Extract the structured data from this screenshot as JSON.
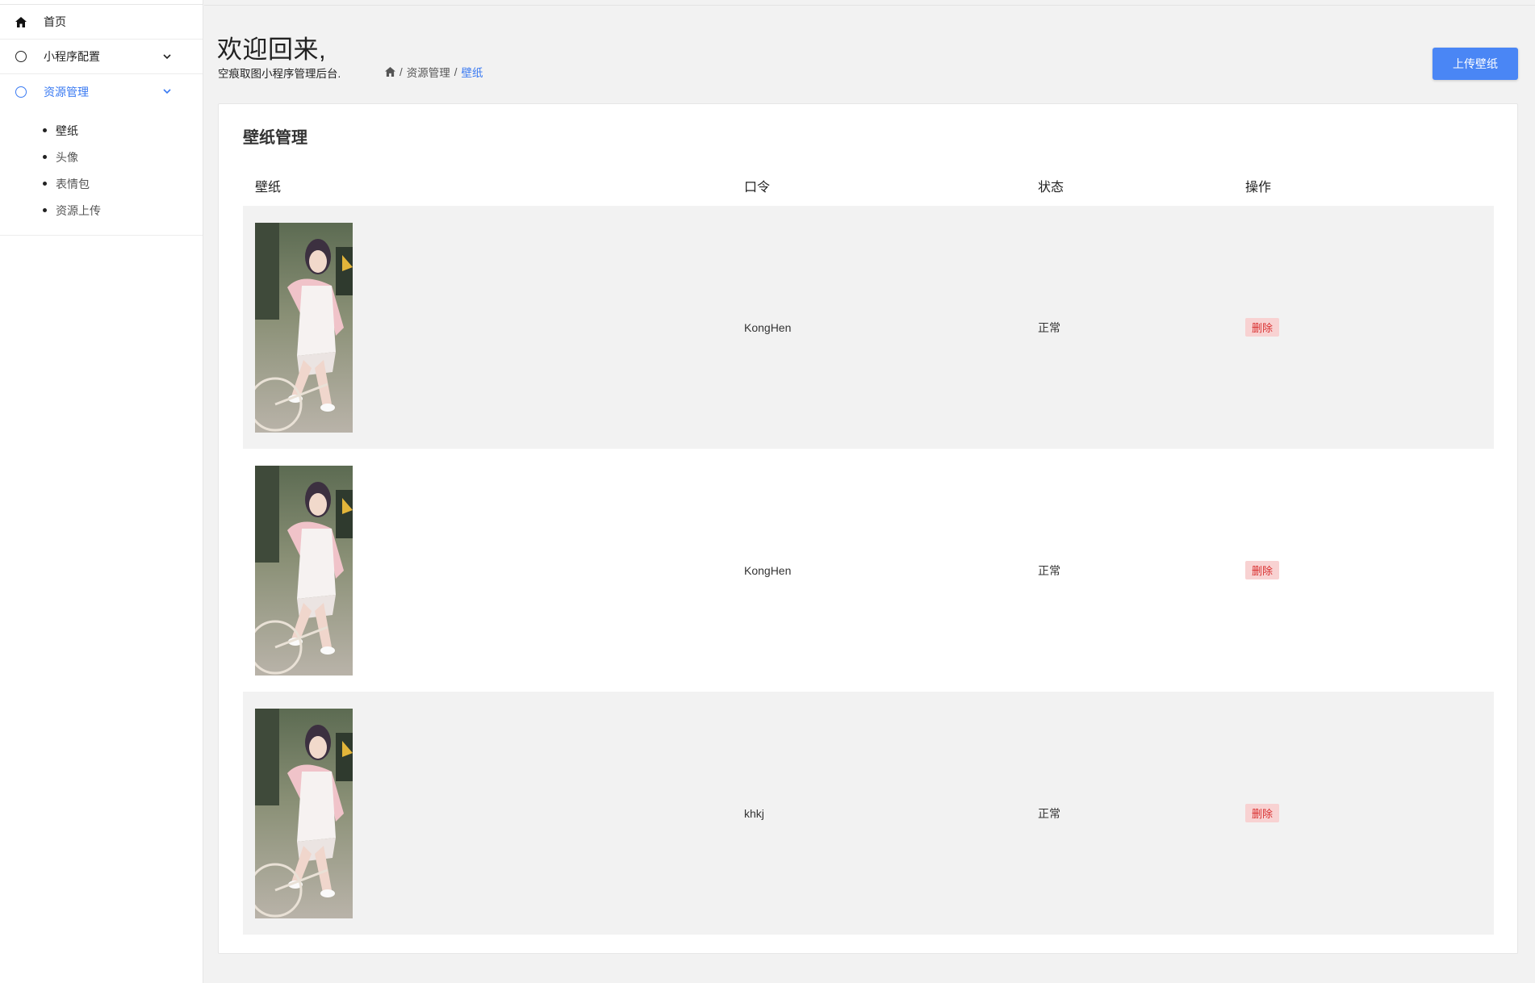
{
  "sidebar": {
    "items": [
      {
        "label": "首页",
        "icon": "home-icon"
      },
      {
        "label": "小程序配置",
        "icon": "circle-icon",
        "chevron": true
      },
      {
        "label": "资源管理",
        "icon": "circle-icon",
        "chevron": true,
        "active": true
      }
    ],
    "submenu": [
      {
        "label": "壁纸",
        "current": true
      },
      {
        "label": "头像"
      },
      {
        "label": "表情包"
      },
      {
        "label": "资源上传"
      }
    ]
  },
  "header": {
    "title": "欢迎回来,",
    "subtitle": "空痕取图小程序管理后台.",
    "breadcrumb": [
      "资源管理",
      "壁纸"
    ],
    "upload_label": "上传壁纸"
  },
  "card": {
    "title": "壁纸管理",
    "columns": [
      "壁纸",
      "口令",
      "状态",
      "操作"
    ],
    "rows": [
      {
        "code": "KongHen",
        "status": "正常",
        "action": "删除"
      },
      {
        "code": "KongHen",
        "status": "正常",
        "action": "删除"
      },
      {
        "code": "khkj",
        "status": "正常",
        "action": "删除"
      }
    ]
  },
  "colors": {
    "accent": "#3a7af2",
    "button": "#4a86f5",
    "danger_bg": "#f8d2d2",
    "danger_text": "#d93030"
  }
}
